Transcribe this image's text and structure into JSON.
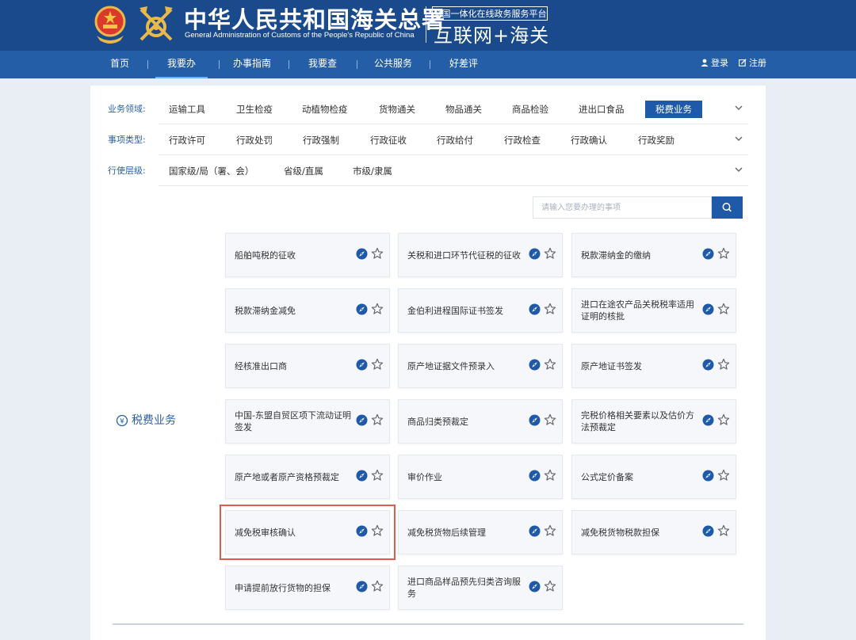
{
  "header": {
    "title_cn": "中华人民共和国海关总署",
    "title_en": "General Administration of Customs of the People's Republic of China",
    "platform_badge": "全国一体化在线政务服务平台",
    "platform_name": "互联网+海关"
  },
  "nav": {
    "items": [
      "首页",
      "我要办",
      "办事指南",
      "我要查",
      "公共服务",
      "好差评"
    ],
    "active_index": 1,
    "login": "登录",
    "register": "注册"
  },
  "filters": [
    {
      "label": "业务领域:",
      "options": [
        "运输工具",
        "卫生检疫",
        "动植物检疫",
        "货物通关",
        "物品通关",
        "商品检验",
        "进出口食品",
        "税费业务"
      ],
      "selected_index": 7
    },
    {
      "label": "事项类型:",
      "options": [
        "行政许可",
        "行政处罚",
        "行政强制",
        "行政征收",
        "行政给付",
        "行政检查",
        "行政确认",
        "行政奖励"
      ],
      "selected_index": -1
    },
    {
      "label": "行使层级:",
      "options": [
        "国家级/局（署、会）",
        "省级/直属",
        "市级/隶属"
      ],
      "selected_index": -1
    }
  ],
  "search": {
    "placeholder": "请输入您要办理的事项"
  },
  "category": {
    "label": "税费业务"
  },
  "services": [
    "船舶吨税的征收",
    "关税和进口环节代征税的征收",
    "税款滞纳金的缴纳",
    "税款滞纳金减免",
    "金伯利进程国际证书签发",
    "进口在途农产品关税税率适用证明的核批",
    "经核准出口商",
    "原产地证据文件预录入",
    "原产地证书签发",
    "中国-东盟自贸区项下流动证明签发",
    "商品归类预裁定",
    "完税价格相关要素以及估价方法预裁定",
    "原产地或者原产资格预裁定",
    "审价作业",
    "公式定价备案",
    "减免税审核确认",
    "减免税货物后续管理",
    "减免税货物税款担保",
    "申请提前放行货物的担保",
    "进口商品样品预先归类咨询服务"
  ],
  "highlighted_service_index": 15,
  "icons": {
    "card_actions": [
      "compass-icon",
      "star-icon"
    ],
    "nav_right": [
      "user-icon",
      "register-icon"
    ],
    "search": "search-icon"
  },
  "colors": {
    "header_bg": "#1a4a8c",
    "nav_bg": "#245ea6",
    "accent": "#1f5aa8",
    "highlight_border": "#e05a4e"
  }
}
